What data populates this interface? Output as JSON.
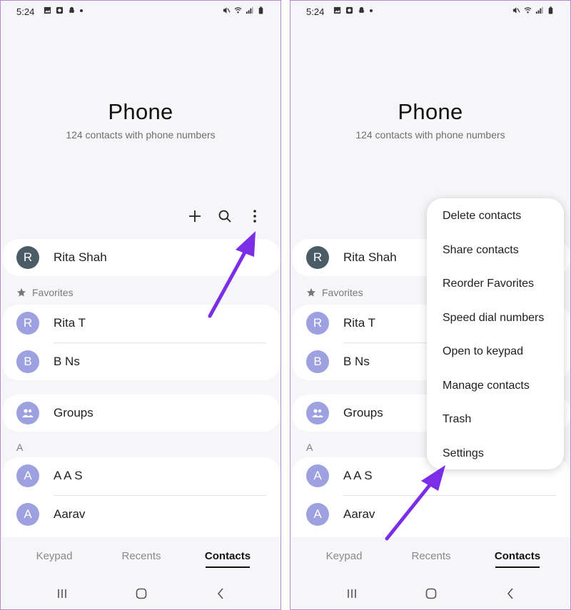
{
  "status": {
    "time": "5:24"
  },
  "header": {
    "title": "Phone",
    "subtitle": "124 contacts with phone numbers"
  },
  "profile": {
    "name": "Rita Shah",
    "initial": "R"
  },
  "favorites": {
    "label": "Favorites",
    "items": [
      {
        "name": "Rita T",
        "initial": "R"
      },
      {
        "name": "B Ns",
        "initial": "B"
      }
    ]
  },
  "groups": {
    "label": "Groups"
  },
  "section_a": {
    "label": "A",
    "items": [
      {
        "name": "A A S",
        "initial": "A"
      },
      {
        "name": "Aarav",
        "initial": "A"
      }
    ]
  },
  "tabs": {
    "keypad": "Keypad",
    "recents": "Recents",
    "contacts": "Contacts",
    "active": "contacts"
  },
  "menu": {
    "items": [
      "Delete contacts",
      "Share contacts",
      "Reorder Favorites",
      "Speed dial numbers",
      "Open to keypad",
      "Manage contacts",
      "Trash",
      "Settings"
    ]
  },
  "icons": {
    "add": "plus-icon",
    "search": "search-icon",
    "more": "more-vertical-icon",
    "favorites": "star-icon",
    "groups": "people-icon",
    "nav_recents": "recent-apps-icon",
    "nav_home": "home-icon",
    "nav_back": "back-icon"
  },
  "colors": {
    "annotation_arrow": "#7b2ee6",
    "avatar_dark": "#4b5c67",
    "avatar_light": "#9ea1e0"
  }
}
